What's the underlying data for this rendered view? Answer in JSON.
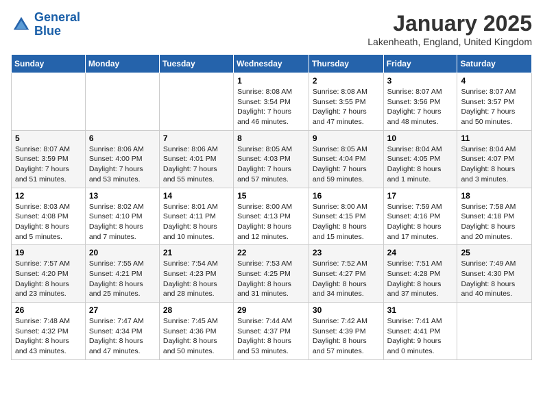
{
  "header": {
    "logo_line1": "General",
    "logo_line2": "Blue",
    "month": "January 2025",
    "location": "Lakenheath, England, United Kingdom"
  },
  "weekdays": [
    "Sunday",
    "Monday",
    "Tuesday",
    "Wednesday",
    "Thursday",
    "Friday",
    "Saturday"
  ],
  "weeks": [
    [
      {
        "day": "",
        "info": ""
      },
      {
        "day": "",
        "info": ""
      },
      {
        "day": "",
        "info": ""
      },
      {
        "day": "1",
        "info": "Sunrise: 8:08 AM\nSunset: 3:54 PM\nDaylight: 7 hours and 46 minutes."
      },
      {
        "day": "2",
        "info": "Sunrise: 8:08 AM\nSunset: 3:55 PM\nDaylight: 7 hours and 47 minutes."
      },
      {
        "day": "3",
        "info": "Sunrise: 8:07 AM\nSunset: 3:56 PM\nDaylight: 7 hours and 48 minutes."
      },
      {
        "day": "4",
        "info": "Sunrise: 8:07 AM\nSunset: 3:57 PM\nDaylight: 7 hours and 50 minutes."
      }
    ],
    [
      {
        "day": "5",
        "info": "Sunrise: 8:07 AM\nSunset: 3:59 PM\nDaylight: 7 hours and 51 minutes."
      },
      {
        "day": "6",
        "info": "Sunrise: 8:06 AM\nSunset: 4:00 PM\nDaylight: 7 hours and 53 minutes."
      },
      {
        "day": "7",
        "info": "Sunrise: 8:06 AM\nSunset: 4:01 PM\nDaylight: 7 hours and 55 minutes."
      },
      {
        "day": "8",
        "info": "Sunrise: 8:05 AM\nSunset: 4:03 PM\nDaylight: 7 hours and 57 minutes."
      },
      {
        "day": "9",
        "info": "Sunrise: 8:05 AM\nSunset: 4:04 PM\nDaylight: 7 hours and 59 minutes."
      },
      {
        "day": "10",
        "info": "Sunrise: 8:04 AM\nSunset: 4:05 PM\nDaylight: 8 hours and 1 minute."
      },
      {
        "day": "11",
        "info": "Sunrise: 8:04 AM\nSunset: 4:07 PM\nDaylight: 8 hours and 3 minutes."
      }
    ],
    [
      {
        "day": "12",
        "info": "Sunrise: 8:03 AM\nSunset: 4:08 PM\nDaylight: 8 hours and 5 minutes."
      },
      {
        "day": "13",
        "info": "Sunrise: 8:02 AM\nSunset: 4:10 PM\nDaylight: 8 hours and 7 minutes."
      },
      {
        "day": "14",
        "info": "Sunrise: 8:01 AM\nSunset: 4:11 PM\nDaylight: 8 hours and 10 minutes."
      },
      {
        "day": "15",
        "info": "Sunrise: 8:00 AM\nSunset: 4:13 PM\nDaylight: 8 hours and 12 minutes."
      },
      {
        "day": "16",
        "info": "Sunrise: 8:00 AM\nSunset: 4:15 PM\nDaylight: 8 hours and 15 minutes."
      },
      {
        "day": "17",
        "info": "Sunrise: 7:59 AM\nSunset: 4:16 PM\nDaylight: 8 hours and 17 minutes."
      },
      {
        "day": "18",
        "info": "Sunrise: 7:58 AM\nSunset: 4:18 PM\nDaylight: 8 hours and 20 minutes."
      }
    ],
    [
      {
        "day": "19",
        "info": "Sunrise: 7:57 AM\nSunset: 4:20 PM\nDaylight: 8 hours and 23 minutes."
      },
      {
        "day": "20",
        "info": "Sunrise: 7:55 AM\nSunset: 4:21 PM\nDaylight: 8 hours and 25 minutes."
      },
      {
        "day": "21",
        "info": "Sunrise: 7:54 AM\nSunset: 4:23 PM\nDaylight: 8 hours and 28 minutes."
      },
      {
        "day": "22",
        "info": "Sunrise: 7:53 AM\nSunset: 4:25 PM\nDaylight: 8 hours and 31 minutes."
      },
      {
        "day": "23",
        "info": "Sunrise: 7:52 AM\nSunset: 4:27 PM\nDaylight: 8 hours and 34 minutes."
      },
      {
        "day": "24",
        "info": "Sunrise: 7:51 AM\nSunset: 4:28 PM\nDaylight: 8 hours and 37 minutes."
      },
      {
        "day": "25",
        "info": "Sunrise: 7:49 AM\nSunset: 4:30 PM\nDaylight: 8 hours and 40 minutes."
      }
    ],
    [
      {
        "day": "26",
        "info": "Sunrise: 7:48 AM\nSunset: 4:32 PM\nDaylight: 8 hours and 43 minutes."
      },
      {
        "day": "27",
        "info": "Sunrise: 7:47 AM\nSunset: 4:34 PM\nDaylight: 8 hours and 47 minutes."
      },
      {
        "day": "28",
        "info": "Sunrise: 7:45 AM\nSunset: 4:36 PM\nDaylight: 8 hours and 50 minutes."
      },
      {
        "day": "29",
        "info": "Sunrise: 7:44 AM\nSunset: 4:37 PM\nDaylight: 8 hours and 53 minutes."
      },
      {
        "day": "30",
        "info": "Sunrise: 7:42 AM\nSunset: 4:39 PM\nDaylight: 8 hours and 57 minutes."
      },
      {
        "day": "31",
        "info": "Sunrise: 7:41 AM\nSunset: 4:41 PM\nDaylight: 9 hours and 0 minutes."
      },
      {
        "day": "",
        "info": ""
      }
    ]
  ]
}
